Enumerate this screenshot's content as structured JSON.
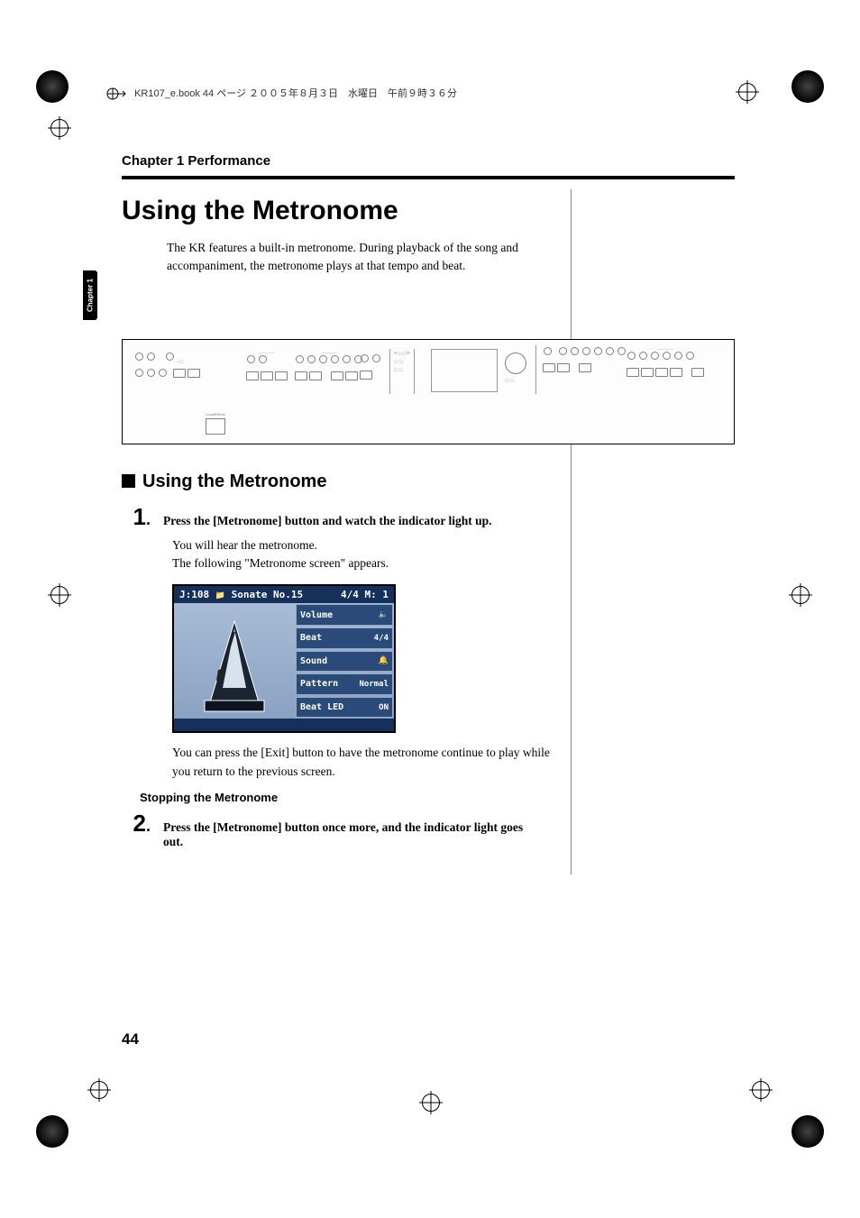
{
  "header": {
    "running": "KR107_e.book  44 ページ  ２００５年８月３日　水曜日　午前９時３６分"
  },
  "sideTab": "Chapter 1",
  "chapterHeader": "Chapter 1 Performance",
  "title": "Using the Metronome",
  "intro": "The KR features a built-in metronome. During playback of the song and accompaniment, the metronome plays at that tempo and beat.",
  "subhead": "Using the Metronome",
  "step1": {
    "num": "1",
    "text": "Press the [Metronome] button and watch the indicator light up."
  },
  "afterStep1a": "You will hear the metronome.",
  "afterStep1b": "The following \"Metronome screen\" appears.",
  "lcd": {
    "topLeft": "J:108",
    "topMid": "Sonate No.15",
    "topRight": "4/4  M:   1",
    "rows": [
      {
        "label": "Volume",
        "val": "🔈"
      },
      {
        "label": "Beat",
        "val": "4/4"
      },
      {
        "label": "Sound",
        "val": "🔔"
      },
      {
        "label": "Pattern",
        "val": "Normal"
      },
      {
        "label": "Beat LED",
        "val": "ON"
      }
    ]
  },
  "afterLcd": "You can press the [Exit] button to have the metronome continue to play while you return to the previous screen.",
  "stopHeading": "Stopping the Metronome",
  "step2": {
    "num": "2",
    "text": "Press the [Metronome] button once more, and the indicator light goes out."
  },
  "pageNum": "44"
}
